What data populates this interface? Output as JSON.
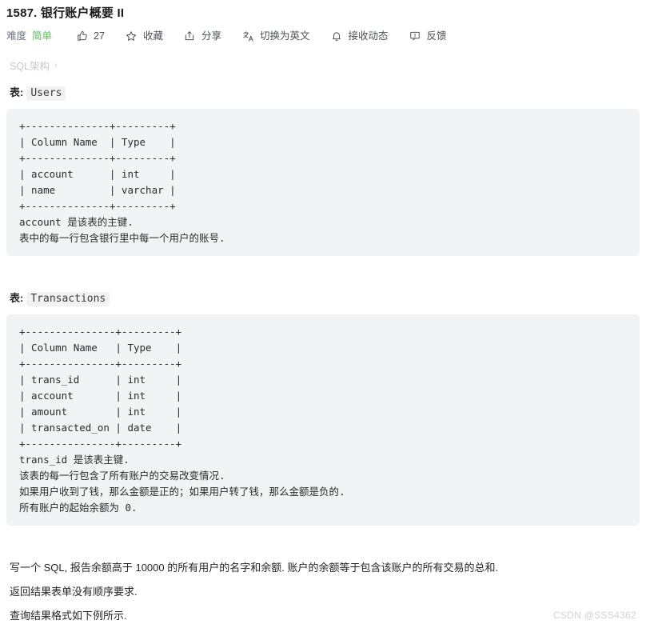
{
  "header": {
    "title": "1587. 银行账户概要 II"
  },
  "toolbar": {
    "difficulty_label": "难度",
    "difficulty_value": "简单",
    "difficulty_color": "#5bbf5b",
    "items": [
      {
        "icon": "thumbs-up-icon",
        "label": "27"
      },
      {
        "icon": "star-icon",
        "label": "收藏"
      },
      {
        "icon": "share-icon",
        "label": "分享"
      },
      {
        "icon": "translate-icon",
        "label": "切换为英文"
      },
      {
        "icon": "bell-icon",
        "label": "接收动态"
      },
      {
        "icon": "feedback-icon",
        "label": "反馈"
      }
    ]
  },
  "breadcrumb": {
    "label": "SQL架构",
    "chevron": "›"
  },
  "sections": [
    {
      "caption_label": "表:",
      "caption_code": "Users",
      "code": "+--------------+---------+\n| Column Name  | Type    |\n+--------------+---------+\n| account      | int     |\n| name         | varchar |\n+--------------+---------+\naccount 是该表的主键.\n表中的每一行包含银行里中每一个用户的账号."
    },
    {
      "caption_label": "表:",
      "caption_code": "Transactions",
      "code": "+---------------+---------+\n| Column Name   | Type    |\n+---------------+---------+\n| trans_id      | int     |\n| account       | int     |\n| amount        | int     |\n| transacted_on | date    |\n+---------------+---------+\ntrans_id 是该表主键.\n该表的每一行包含了所有账户的交易改变情况.\n如果用户收到了钱，那么金额是正的；如果用户转了钱，那么金额是负的.\n所有账户的起始余额为 0."
    }
  ],
  "description": {
    "paragraphs": [
      "写一个 SQL, 报告余额高于 10000 的所有用户的名字和余额. 账户的余额等于包含该账户的所有交易的总和.",
      "返回结果表单没有顺序要求.",
      "查询结果格式如下例所示."
    ]
  },
  "watermark": {
    "text": "CSDN @SSS4362"
  }
}
